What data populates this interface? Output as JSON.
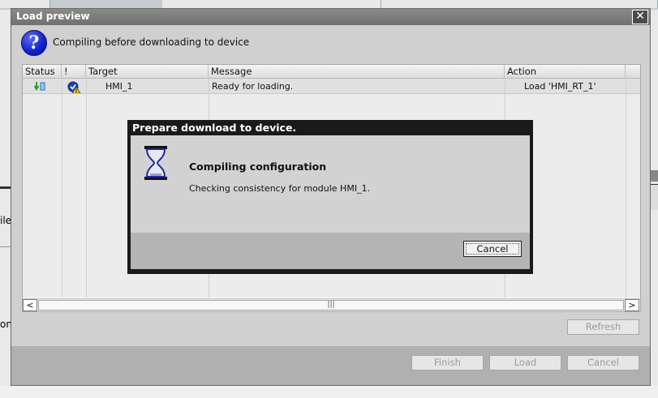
{
  "dialog": {
    "title": "Load preview",
    "heading": "Compiling before downloading to device"
  },
  "table": {
    "columns": [
      "Status",
      "!",
      "Target",
      "Message",
      "Action"
    ],
    "rows": [
      {
        "target": "HMI_1",
        "message": "Ready for loading.",
        "action": "Load 'HMI_RT_1'"
      }
    ]
  },
  "buttons": {
    "refresh": "Refresh",
    "finish": "Finish",
    "load": "Load",
    "cancel": "Cancel"
  },
  "progress": {
    "title": "Prepare download to device.",
    "heading": "Compiling configuration",
    "text": "Checking consistency for module HMI_1.",
    "cancel": "Cancel"
  },
  "background": {
    "left_fragment_1": "ile",
    "left_fragment_2": "on"
  },
  "colors": {
    "titlebar": "#7a7a7a",
    "help_icon": "#1a2ad0"
  }
}
